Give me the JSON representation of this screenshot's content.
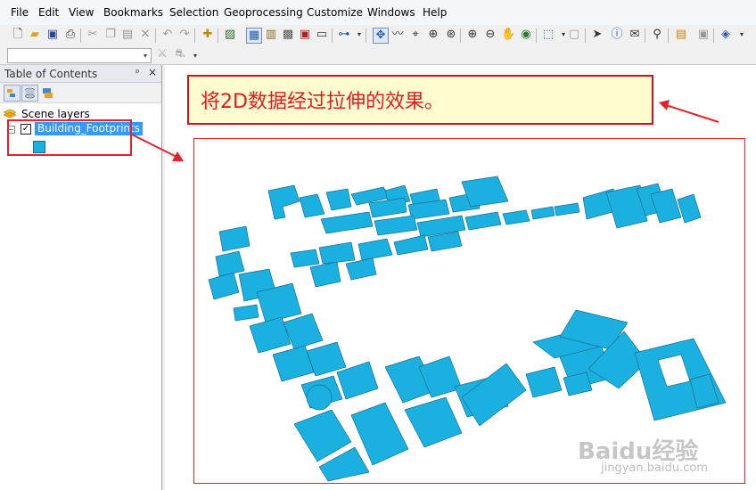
{
  "menu": [
    "File",
    "Edit",
    "View",
    "Bookmarks",
    "Selection",
    "Geoprocessing",
    "Customize",
    "Windows",
    "Help"
  ],
  "toolbar_icons": [
    "new-document-icon",
    "open-folder-icon",
    "save-icon",
    "print-icon",
    "cut-icon",
    "copy-icon",
    "paste-icon",
    "delete-icon",
    "undo-icon",
    "redo-icon",
    "add-data-icon",
    "layout-view-icon",
    "data-view-icon",
    "catalog-icon",
    "toolbox-icon",
    "python-window-icon",
    "model-builder-icon",
    "navigate-icon",
    "fly-icon",
    "center-target-icon",
    "zoom-to-target-icon",
    "set-observer-icon",
    "zoom-in-icon",
    "zoom-out-icon",
    "pan-icon",
    "full-extent-icon",
    "select-features-icon",
    "clear-selection-icon",
    "select-elements-icon",
    "identify-icon",
    "html-popup-icon",
    "find-icon",
    "time-slider-icon",
    "scene-properties-icon",
    "3d-effects-icon"
  ],
  "toc": {
    "title": "Table of Contents",
    "pin": "ᵖ",
    "close": "×",
    "root_label": "Scene layers",
    "layer_name": "Building_Footprints",
    "checked": "✓",
    "expander": "−",
    "swatch_color": "#1ab0e0"
  },
  "callout": {
    "text": "将2D数据经过拉伸的效果。"
  },
  "colors": {
    "building_fill": "#1ab0e0",
    "building_stroke": "#1a6f99",
    "highlight_red": "#e0232c",
    "callout_bg": "#fffdd0"
  },
  "watermark": {
    "brand": "Baidu经验",
    "url": "jingyan.baidu.com"
  }
}
